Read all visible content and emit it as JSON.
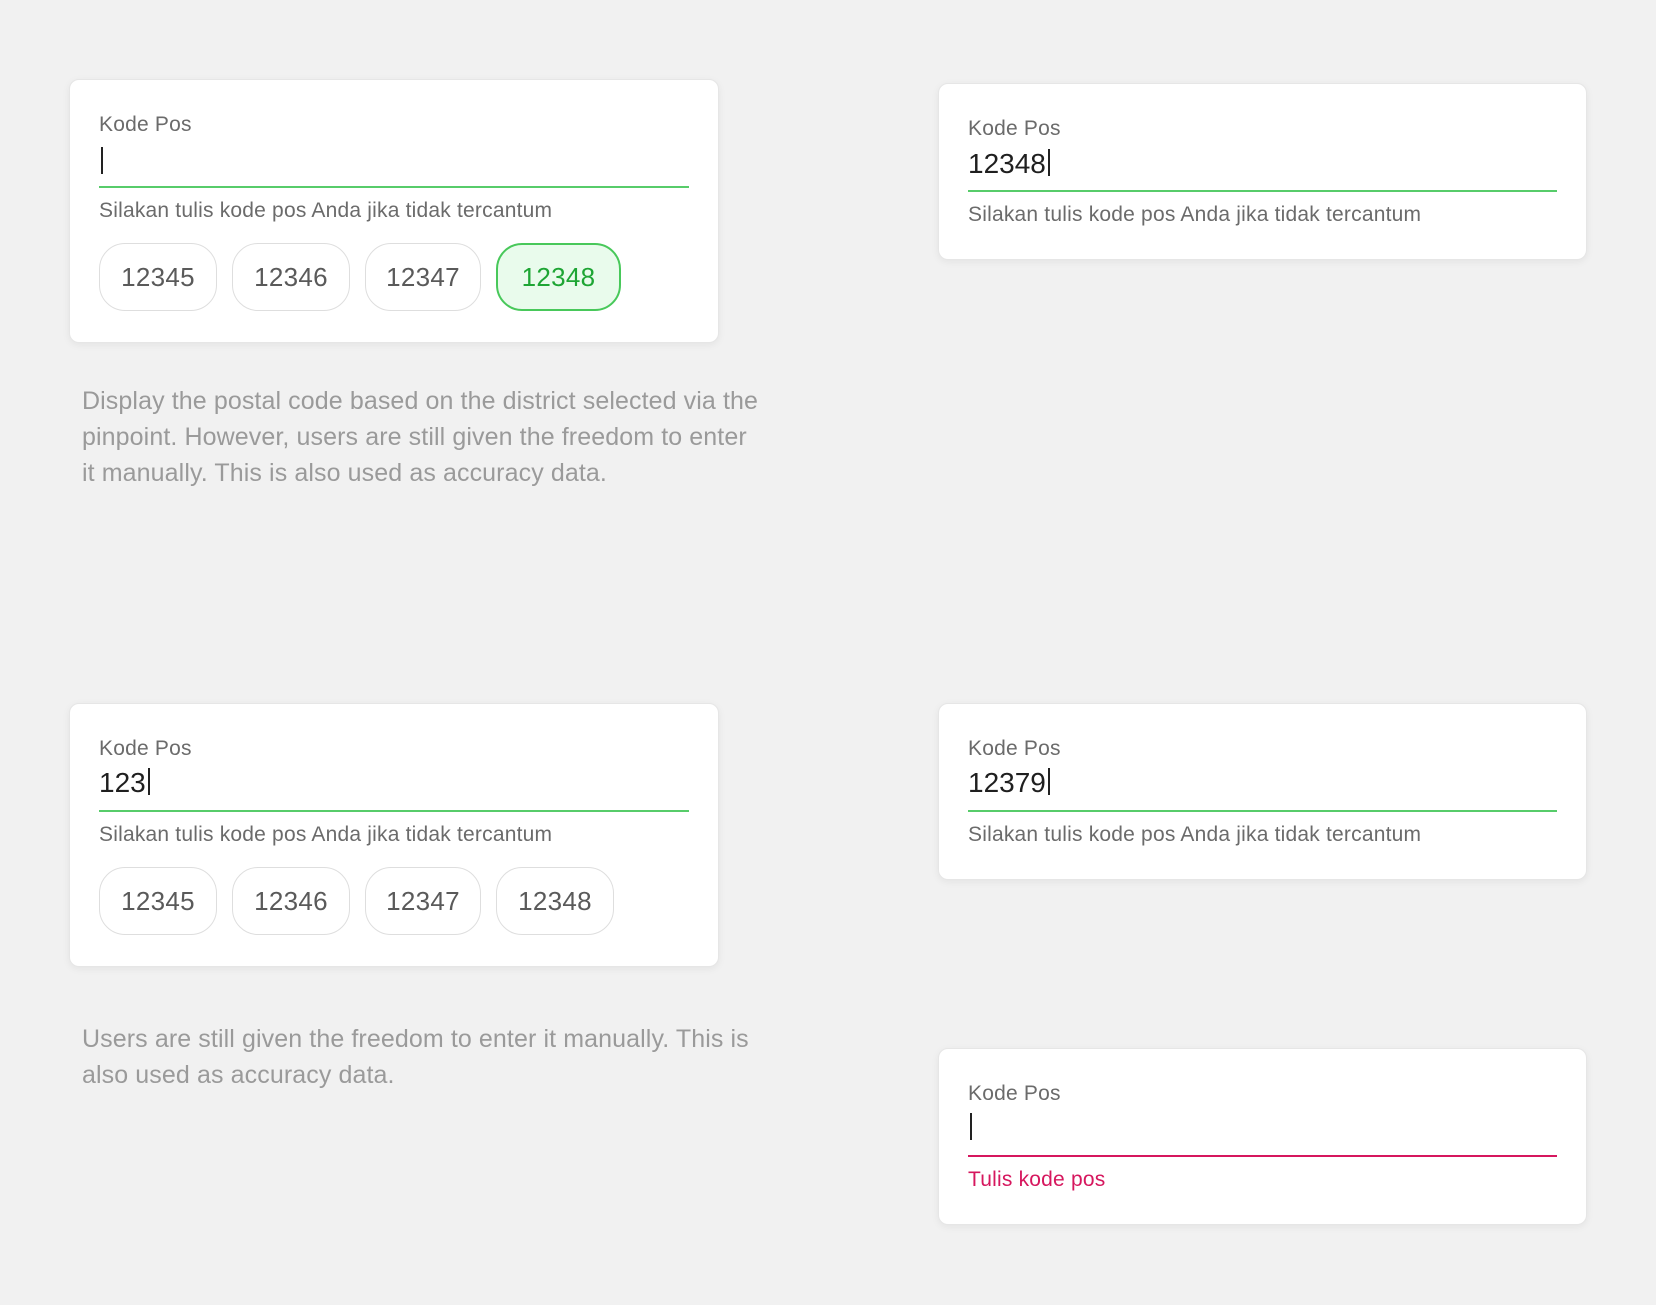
{
  "card1": {
    "label": "Kode Pos",
    "value": "",
    "helper": "Silakan tulis kode pos Anda jika tidak tercantum",
    "chips": [
      {
        "label": "12345",
        "selected": false
      },
      {
        "label": "12346",
        "selected": false
      },
      {
        "label": "12347",
        "selected": false
      },
      {
        "label": "12348",
        "selected": true
      }
    ]
  },
  "card2": {
    "label": "Kode Pos",
    "value": "12348",
    "helper": "Silakan tulis kode pos Anda jika tidak tercantum"
  },
  "card3": {
    "label": "Kode Pos",
    "value": "123",
    "helper": "Silakan tulis kode pos Anda jika tidak tercantum",
    "chips": [
      {
        "label": "12345",
        "selected": false
      },
      {
        "label": "12346",
        "selected": false
      },
      {
        "label": "12347",
        "selected": false
      },
      {
        "label": "12348",
        "selected": false
      }
    ]
  },
  "card4": {
    "label": "Kode Pos",
    "value": "12379",
    "helper": "Silakan tulis kode pos Anda jika tidak tercantum"
  },
  "card5": {
    "label": "Kode Pos",
    "value": "",
    "error": "Tulis kode pos"
  },
  "descriptions": {
    "top": "Display the postal code based on the district selected via the pinpoint. However, users are still given the freedom to enter it manually. This is also used as accuracy data.",
    "bottom": "Users are still given the freedom to enter it manually. This is also used as accuracy data."
  },
  "colors": {
    "background": "#f1f1f1",
    "accent_green": "#57cc6a",
    "selected_chip_bg": "#e9fbec",
    "selected_chip_text": "#1ea534",
    "error": "#d6175e"
  },
  "icons": {
    "caret": "text-cursor-icon"
  }
}
